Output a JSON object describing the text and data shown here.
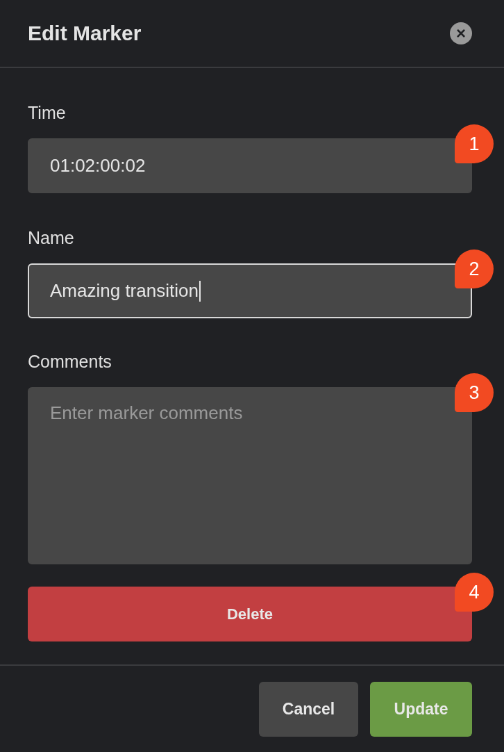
{
  "dialog": {
    "title": "Edit Marker",
    "close_label": "×"
  },
  "fields": [
    {
      "kind": "input",
      "label": "Time",
      "value": "01:02:00:02",
      "focused": false,
      "callout": "1"
    },
    {
      "kind": "input",
      "label": "Name",
      "value": "Amazing transition",
      "focused": true,
      "callout": "2"
    },
    {
      "kind": "textarea",
      "label": "Comments",
      "placeholder": "Enter marker comments",
      "focused": false,
      "callout": "3"
    }
  ],
  "delete_button": {
    "label": "Delete",
    "callout": "4"
  },
  "buttons": [
    {
      "label": "Cancel",
      "kind": "secondary"
    },
    {
      "label": "Update",
      "kind": "primary"
    }
  ]
}
